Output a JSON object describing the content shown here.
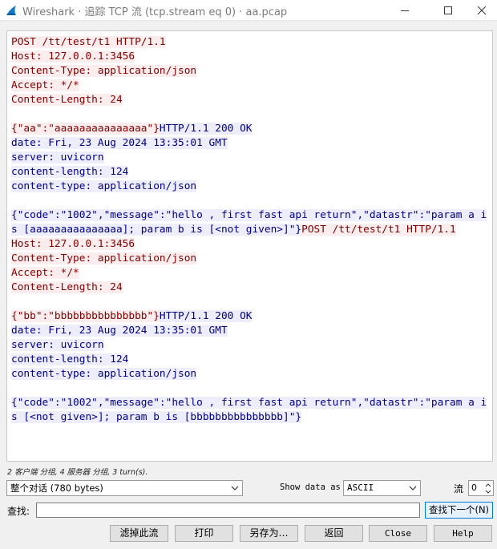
{
  "window": {
    "title": "Wireshark · 追踪 TCP 流 (tcp.stream eq 0) · aa.pcap",
    "icon": "wireshark-fin-icon"
  },
  "stream": {
    "colors": {
      "client_fg": "#800000",
      "client_bg": "#fbeded",
      "server_fg": "#000080",
      "server_bg": "#ededfb"
    },
    "segments": [
      {
        "side": "client",
        "text": "POST /tt/test/t1 HTTP/1.1\nHost: 127.0.0.1:3456\nContent-Type: application/json\nAccept: */*\nContent-Length: 24\n\n{\"aa\":\"aaaaaaaaaaaaaaa\"}"
      },
      {
        "side": "server",
        "text": "HTTP/1.1 200 OK\ndate: Fri, 23 Aug 2024 13:35:01 GMT\nserver: uvicorn\ncontent-length: 124\ncontent-type: application/json\n\n{\"code\":\"1002\",\"message\":\"hello , first fast api return\",\"datastr\":\"param a is [aaaaaaaaaaaaaaa]; param b is [<not given>]\"}"
      },
      {
        "side": "client",
        "text": "POST /tt/test/t1 HTTP/1.1\nHost: 127.0.0.1:3456\nContent-Type: application/json\nAccept: */*\nContent-Length: 24\n\n{\"bb\":\"bbbbbbbbbbbbbbb\"}"
      },
      {
        "side": "server",
        "text": "HTTP/1.1 200 OK\ndate: Fri, 23 Aug 2024 13:35:01 GMT\nserver: uvicorn\ncontent-length: 124\ncontent-type: application/json\n\n{\"code\":\"1002\",\"message\":\"hello , first fast api return\",\"datastr\":\"param a is [<not given>]; param b is [bbbbbbbbbbbbbbb]\"}"
      }
    ]
  },
  "summary": "2 客户端 分组, 4 服务器 分组, 3 turn(s).",
  "controls": {
    "conversation_select": "整个对话 (780 bytes)",
    "show_data_label": "Show data as",
    "format_select": "ASCII",
    "stream_label": "流",
    "stream_value": "0"
  },
  "find": {
    "label": "查找:",
    "value": "",
    "next_button": "查找下一个(N)"
  },
  "buttons": {
    "filter_out": "滤掉此流",
    "print": "打印",
    "save_as": "另存为…",
    "back": "返回",
    "close": "Close",
    "help": "Help"
  }
}
